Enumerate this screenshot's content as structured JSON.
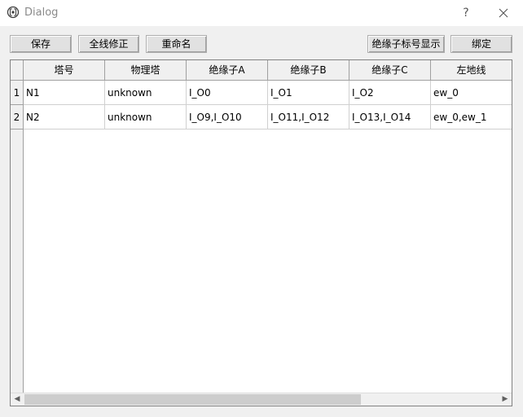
{
  "window": {
    "title": "Dialog",
    "help_label": "?"
  },
  "toolbar": {
    "save": "保存",
    "full_line_fix": "全线修正",
    "rename": "重命名",
    "insulator_label_display": "绝缘子标号显示",
    "bind": "绑定"
  },
  "table": {
    "columns": [
      "塔号",
      "物理塔",
      "绝缘子A",
      "绝缘子B",
      "绝缘子C",
      "左地线"
    ],
    "rows": [
      {
        "num": "1",
        "cells": [
          "N1",
          "unknown",
          "I_O0",
          "I_O1",
          "I_O2",
          "ew_0"
        ]
      },
      {
        "num": "2",
        "cells": [
          "N2",
          "unknown",
          "I_O9,I_O10",
          "I_O11,I_O12",
          "I_O13,I_O14",
          "ew_0,ew_1"
        ]
      }
    ]
  },
  "scrollbar": {
    "left_arrow": "◀",
    "right_arrow": "▶"
  }
}
